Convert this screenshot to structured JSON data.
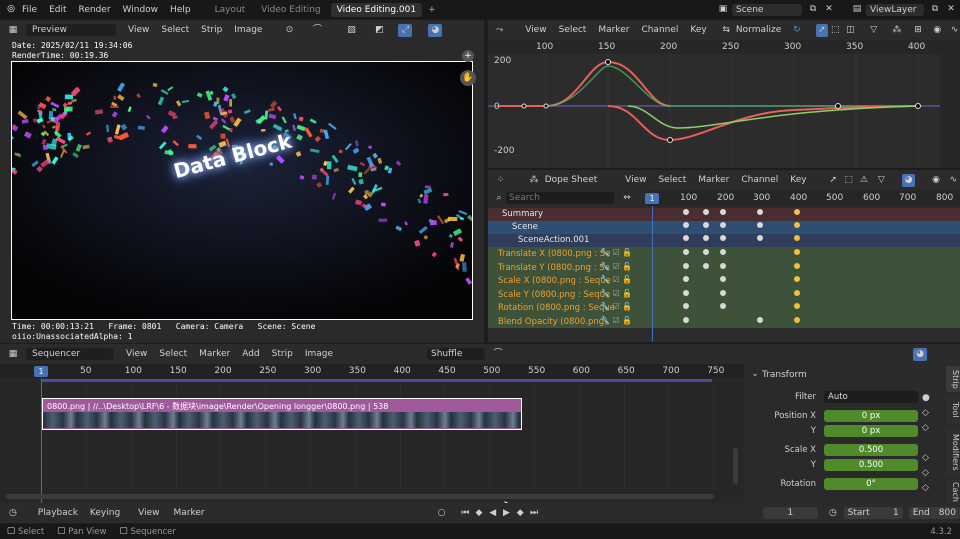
{
  "topbar": {
    "menus": [
      "File",
      "Edit",
      "Render",
      "Window",
      "Help"
    ],
    "workspaces": [
      "Layout",
      "Video Editing",
      "Video Editing.001"
    ],
    "add_tab": "+",
    "scene": "Scene",
    "view_layer": "ViewLayer"
  },
  "preview_header": {
    "mode": "Preview",
    "menus": [
      "View",
      "Select",
      "Strip",
      "Image"
    ]
  },
  "preview": {
    "date": "Date: 2025/02/11 19:34:06",
    "render_time": "RenderTime: 00:19.36",
    "title_text": "Data Block",
    "footer_line1": "Time: 00:00:13:21   Frame: 0801   Camera: Camera   Scene: Scene",
    "footer_line2": "oiio:UnassociatedAlpha: 1"
  },
  "graph_header": {
    "menus": [
      "View",
      "Select",
      "Marker",
      "Channel",
      "Key"
    ],
    "normalize": "Normalize"
  },
  "graph": {
    "x_ticks": [
      "100",
      "150",
      "200",
      "250",
      "300",
      "350",
      "400"
    ],
    "y_ticks": [
      "200",
      "0",
      "-200"
    ]
  },
  "dope_header": {
    "mode": "Dope Sheet",
    "menus": [
      "View",
      "Select",
      "Marker",
      "Channel",
      "Key"
    ]
  },
  "dope": {
    "search_placeholder": "Search",
    "current_frame": "1",
    "x_ticks": [
      "100",
      "200",
      "300",
      "400",
      "500",
      "600",
      "700",
      "800"
    ],
    "summary": "Summary",
    "scene": "Scene",
    "action": "SceneAction.001",
    "channels": [
      "Translate X (0800.png : Se",
      "Translate Y (0800.png : Se",
      "Scale X (0800.png : Seque",
      "Scale Y (0800.png : Seque",
      "Rotation (0800.png : Seque",
      "Blend Opacity (0800.png)"
    ]
  },
  "seq_header": {
    "mode": "Sequencer",
    "menus": [
      "View",
      "Select",
      "Marker",
      "Add",
      "Strip",
      "Image"
    ],
    "overlap": "Shuffle"
  },
  "sequencer": {
    "current_frame": "1",
    "x_ticks": [
      "50",
      "100",
      "150",
      "200",
      "250",
      "300",
      "350",
      "400",
      "450",
      "500",
      "550",
      "600",
      "650",
      "700",
      "750"
    ],
    "strip_label": "0800.png | //..\\Desktop\\LRF\\6 - 数据块\\image\\Render\\Opening longger\\0800.png | 538"
  },
  "sidebar": {
    "panel_title": "Transform",
    "filter_label": "Filter",
    "filter_value": "Auto",
    "position_x_label": "Position X",
    "position_x": "0 px",
    "position_y_label": "Y",
    "position_y": "0 px",
    "scale_x_label": "Scale X",
    "scale_x": "0.500",
    "scale_y_label": "Y",
    "scale_y": "0.500",
    "rotation_label": "Rotation",
    "rotation": "0°",
    "tabs": [
      "Strip",
      "Tool",
      "Modifiers",
      "Cach"
    ]
  },
  "timeline_header": {
    "menus": [
      "Playback",
      "Keying",
      "View",
      "Marker"
    ],
    "current_frame": "1",
    "start_label": "Start",
    "start": "1",
    "end_label": "End",
    "end": "800"
  },
  "status": {
    "items": [
      "Select",
      "Pan View",
      "Sequencer"
    ],
    "version": "4.3.2"
  }
}
